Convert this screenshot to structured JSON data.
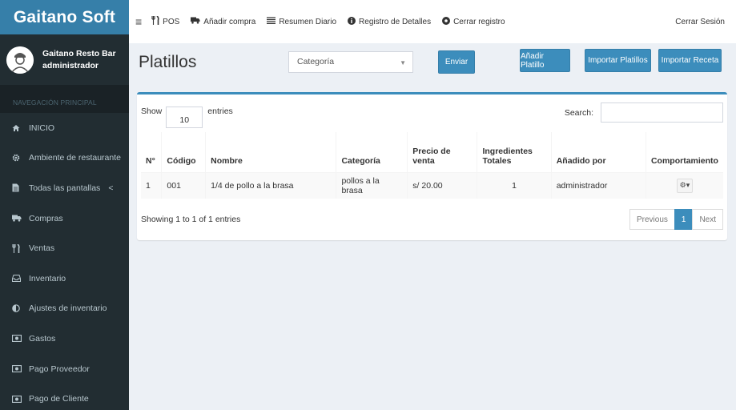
{
  "brand": "Gaitano Soft",
  "user": {
    "name": "Gaitano Resto Bar",
    "role": "administrador"
  },
  "sidebar": {
    "header": "NAVEGACIÓN PRINCIPAL",
    "items": [
      {
        "label": "INICIO",
        "icon": "home-icon"
      },
      {
        "label": "Ambiente de restaurante",
        "icon": "gear-icon"
      },
      {
        "label": "Todas las pantallas",
        "icon": "file-icon",
        "caret": "<"
      },
      {
        "label": "Compras",
        "icon": "truck-icon"
      },
      {
        "label": "Ventas",
        "icon": "cutlery-icon"
      },
      {
        "label": "Inventario",
        "icon": "inbox-icon"
      },
      {
        "label": "Ajustes de inventario",
        "icon": "adjust-icon"
      },
      {
        "label": "Gastos",
        "icon": "money-icon"
      },
      {
        "label": "Pago Proveedor",
        "icon": "money-icon"
      },
      {
        "label": "Pago de Cliente",
        "icon": "money-icon"
      }
    ]
  },
  "topbar": {
    "items": [
      {
        "label": "POS",
        "icon": "cutlery-icon"
      },
      {
        "label": "Añadir compra",
        "icon": "truck-icon"
      },
      {
        "label": "Resumen Diario",
        "icon": "list-icon"
      },
      {
        "label": "Registro de Detalles",
        "icon": "info-icon"
      },
      {
        "label": "Cerrar registro",
        "icon": "gear-icon"
      }
    ],
    "logout": "Cerrar Sesión"
  },
  "page": {
    "title": "Platillos",
    "category_select": "Categoría",
    "enviar": "Enviar",
    "add_dish": "Añadir Platillo",
    "import_dishes": "Importar Platillos",
    "import_recipe": "Importar Receta"
  },
  "table": {
    "show": "Show",
    "length": "10",
    "entries": "entries",
    "search_label": "Search:",
    "columns": [
      "N°",
      "Código",
      "Nombre",
      "Categoría",
      "Precio de venta",
      "Ingredientes Totales",
      "Añadido por",
      "Comportamiento"
    ],
    "rows": [
      {
        "n": "1",
        "codigo": "001",
        "nombre": "1/4 de pollo a la brasa",
        "categoria": "pollos a la brasa",
        "precio": "s/ 20.00",
        "ingredientes": "1",
        "anadido": "administrador"
      }
    ],
    "info": "Showing 1 to 1 of 1 entries",
    "previous": "Previous",
    "page": "1",
    "next": "Next"
  },
  "colors": {
    "sidebar": "#222d32",
    "brand": "#367fa9",
    "primary": "#3c8dbc",
    "background": "#ecf0f5"
  }
}
